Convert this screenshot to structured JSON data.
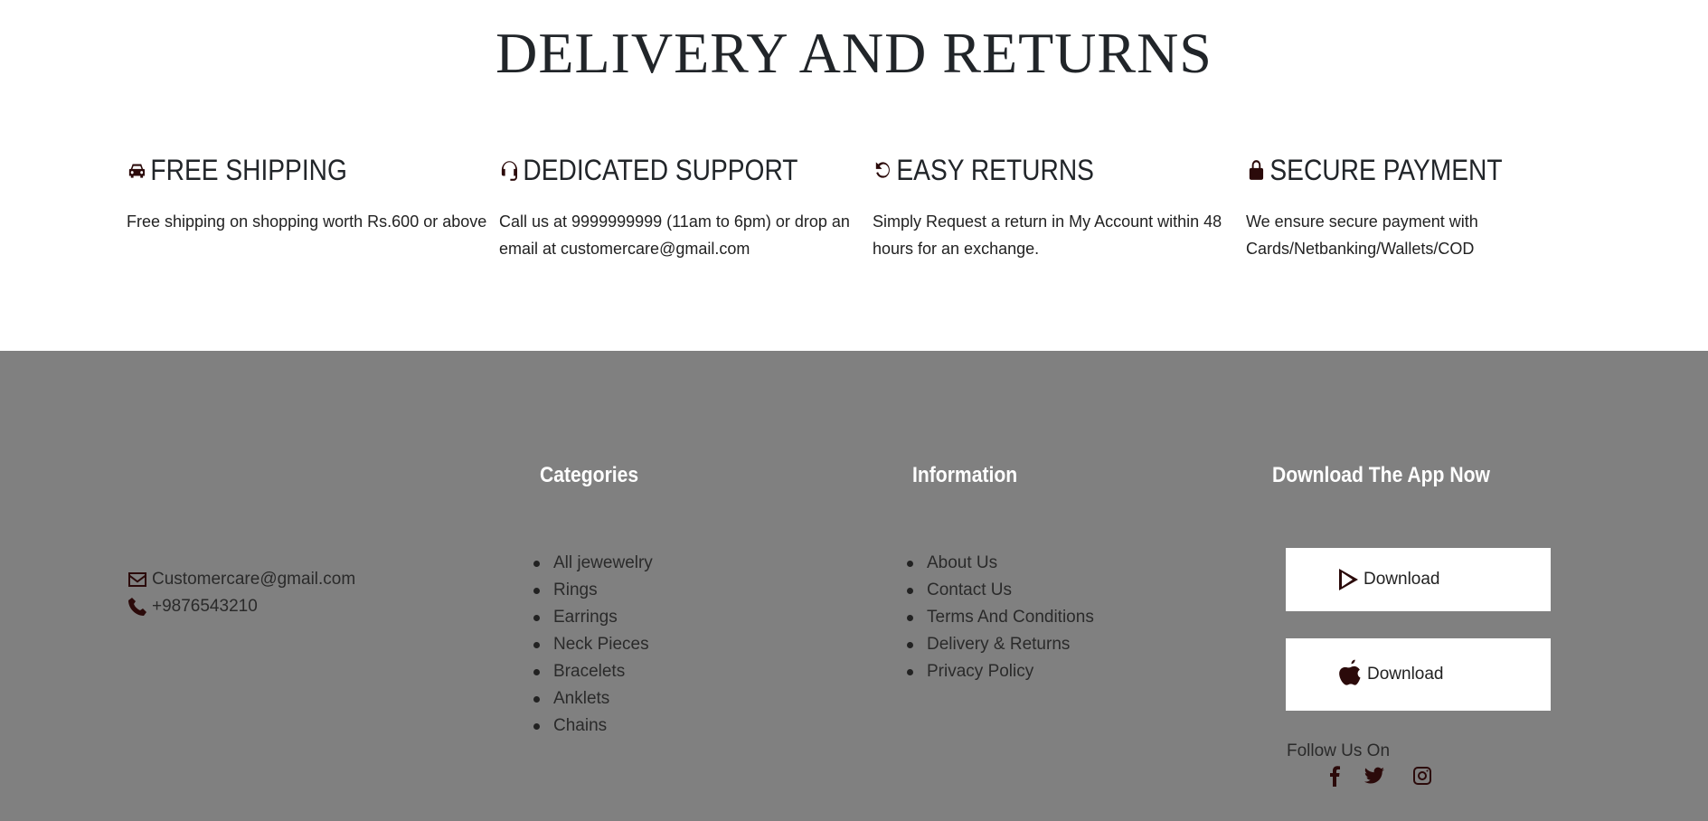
{
  "page_title": "DELIVERY AND RETURNS",
  "features": [
    {
      "icon": "car-icon",
      "title": "FREE SHIPPING",
      "text": "Free shipping on shopping worth Rs.600 or above"
    },
    {
      "icon": "headset-icon",
      "title": "DEDICATED SUPPORT",
      "text": "Call us at 9999999999 (11am to 6pm) or drop an email at customercare@gmail.com"
    },
    {
      "icon": "undo-icon",
      "title": "EASY RETURNS",
      "text": "Simply Request a return in My Account within 48 hours for an exchange."
    },
    {
      "icon": "lock-icon",
      "title": "SECURE PAYMENT",
      "text": "We ensure secure payment with Cards/Netbanking/Wallets/COD"
    }
  ],
  "footer": {
    "background": "#808080",
    "contact": {
      "email": "Customercare@gmail.com",
      "phone": "+9876543210"
    },
    "categories": {
      "heading": "Categories",
      "items": [
        "All jewewelry",
        "Rings",
        "Earrings",
        "Neck Pieces",
        "Bracelets",
        "Anklets",
        "Chains"
      ]
    },
    "information": {
      "heading": "Information",
      "items": [
        "About Us",
        "Contact Us",
        "Terms And Conditions",
        "Delivery & Returns",
        "Privacy Policy"
      ]
    },
    "app": {
      "heading": "Download The App Now",
      "play_label": "Download",
      "apple_label": "Download"
    },
    "follow_label": "Follow Us On",
    "social": [
      "facebook-icon",
      "twitter-icon",
      "instagram-icon"
    ]
  }
}
